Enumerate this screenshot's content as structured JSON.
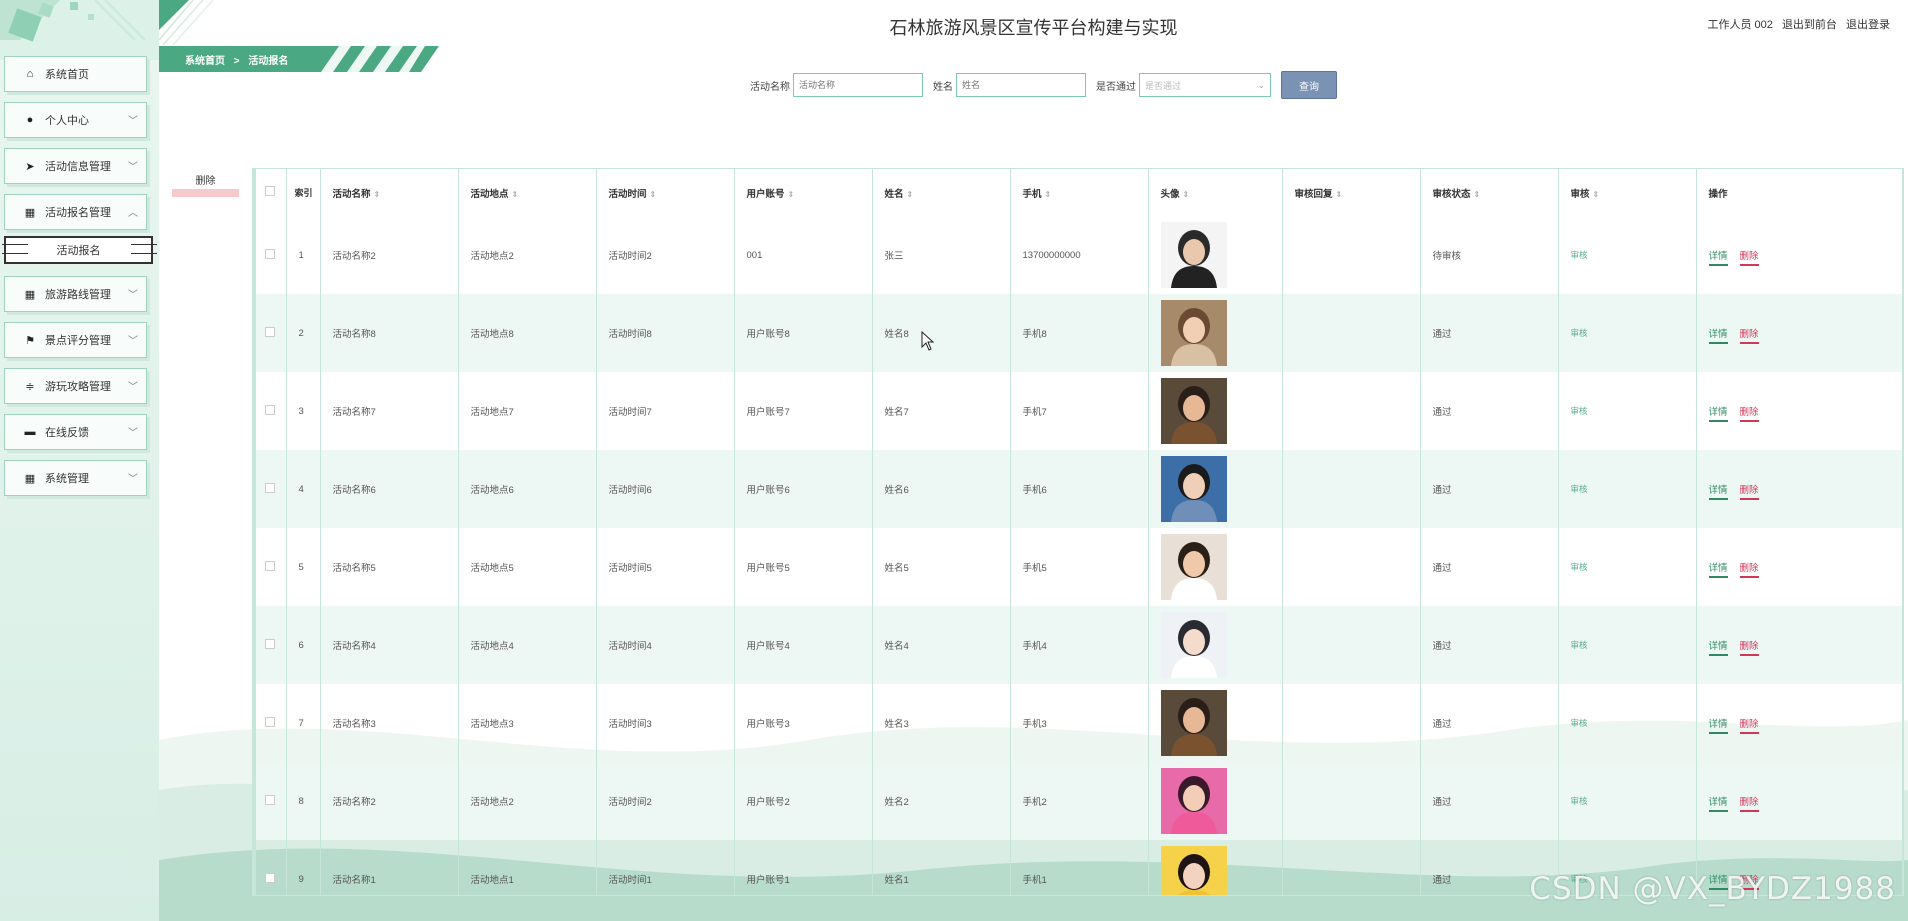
{
  "header": {
    "title": "石林旅游风景区宣传平台构建与实现",
    "user_label": "工作人员 002",
    "to_front": "退出到前台",
    "logout": "退出登录"
  },
  "breadcrumb": {
    "home": "系统首页",
    "separator": ">",
    "current": "活动报名"
  },
  "sidebar": {
    "items": [
      {
        "label": "系统首页",
        "icon": "home-icon"
      },
      {
        "label": "个人中心",
        "icon": "user-icon"
      },
      {
        "label": "活动信息管理",
        "icon": "send-icon"
      },
      {
        "label": "活动报名管理",
        "icon": "grid-icon"
      },
      {
        "label": "旅游路线管理",
        "icon": "grid-icon"
      },
      {
        "label": "景点评分管理",
        "icon": "flag-icon"
      },
      {
        "label": "游玩攻略管理",
        "icon": "sliders-icon"
      },
      {
        "label": "在线反馈",
        "icon": "ticket-icon"
      },
      {
        "label": "系统管理",
        "icon": "grid-icon"
      }
    ],
    "active_sub": "活动报名"
  },
  "search": {
    "activity_label": "活动名称",
    "activity_placeholder": "活动名称",
    "name_label": "姓名",
    "name_placeholder": "姓名",
    "pass_label": "是否通过",
    "pass_placeholder": "是否通过",
    "query_button": "查询"
  },
  "batch_delete": "删除",
  "table": {
    "headers": [
      "索引",
      "活动名称",
      "活动地点",
      "活动时间",
      "用户账号",
      "姓名",
      "手机",
      "头像",
      "审核回复",
      "审核状态",
      "审核",
      "操作"
    ],
    "detail_label": "详情",
    "delete_label": "删除",
    "audit_label": "审核",
    "rows": [
      {
        "idx": "1",
        "name": "活动名称2",
        "place": "活动地点2",
        "time": "活动时间2",
        "account": "001",
        "person": "张三",
        "phone": "13700000000",
        "reply": "",
        "status": "待审核"
      },
      {
        "idx": "2",
        "name": "活动名称8",
        "place": "活动地点8",
        "time": "活动时间8",
        "account": "用户账号8",
        "person": "姓名8",
        "phone": "手机8",
        "reply": "",
        "status": "通过"
      },
      {
        "idx": "3",
        "name": "活动名称7",
        "place": "活动地点7",
        "time": "活动时间7",
        "account": "用户账号7",
        "person": "姓名7",
        "phone": "手机7",
        "reply": "",
        "status": "通过"
      },
      {
        "idx": "4",
        "name": "活动名称6",
        "place": "活动地点6",
        "time": "活动时间6",
        "account": "用户账号6",
        "person": "姓名6",
        "phone": "手机6",
        "reply": "",
        "status": "通过"
      },
      {
        "idx": "5",
        "name": "活动名称5",
        "place": "活动地点5",
        "time": "活动时间5",
        "account": "用户账号5",
        "person": "姓名5",
        "phone": "手机5",
        "reply": "",
        "status": "通过"
      },
      {
        "idx": "6",
        "name": "活动名称4",
        "place": "活动地点4",
        "time": "活动时间4",
        "account": "用户账号4",
        "person": "姓名4",
        "phone": "手机4",
        "reply": "",
        "status": "通过"
      },
      {
        "idx": "7",
        "name": "活动名称3",
        "place": "活动地点3",
        "time": "活动时间3",
        "account": "用户账号3",
        "person": "姓名3",
        "phone": "手机3",
        "reply": "",
        "status": "通过"
      },
      {
        "idx": "8",
        "name": "活动名称2",
        "place": "活动地点2",
        "time": "活动时间2",
        "account": "用户账号2",
        "person": "姓名2",
        "phone": "手机2",
        "reply": "",
        "status": "通过"
      },
      {
        "idx": "9",
        "name": "活动名称1",
        "place": "活动地点1",
        "time": "活动时间1",
        "account": "用户账号1",
        "person": "姓名1",
        "phone": "手机1",
        "reply": "",
        "status": "通过"
      }
    ]
  },
  "watermark": "CSDN @VX_BYDZ1988",
  "colors": {
    "accent": "#4aa882",
    "sidebar_bg": "#e9f6f0",
    "row_alt": "#edf7f3",
    "query_button": "#7a92b4",
    "delete": "#d0385a"
  }
}
